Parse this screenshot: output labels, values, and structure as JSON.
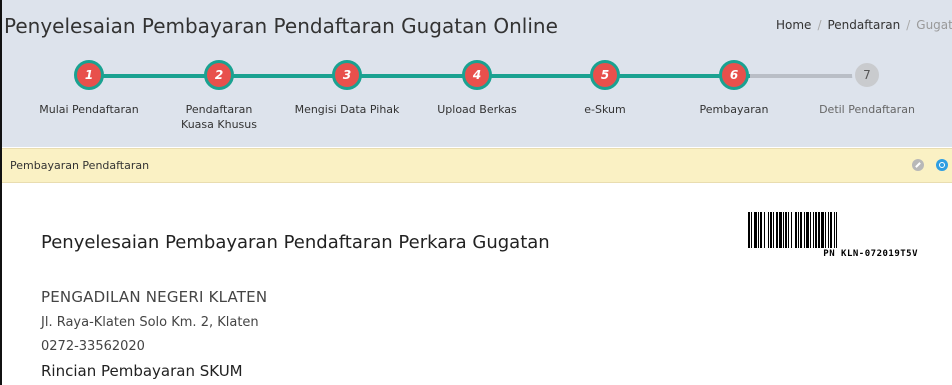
{
  "header": {
    "title": "Penyelesaian Pembayaran Pendaftaran Gugatan Online",
    "breadcrumb": [
      "Home",
      "Pendaftaran",
      "Gugatan"
    ]
  },
  "steps": [
    {
      "number": "1",
      "label": "Mulai Pendaftaran",
      "status": "done"
    },
    {
      "number": "2",
      "label": "Pendaftaran Kuasa Khusus",
      "status": "done"
    },
    {
      "number": "3",
      "label": "Mengisi Data Pihak",
      "status": "done"
    },
    {
      "number": "4",
      "label": "Upload Berkas",
      "status": "done"
    },
    {
      "number": "5",
      "label": "e-Skum",
      "status": "done"
    },
    {
      "number": "6",
      "label": "Pembayaran",
      "status": "done"
    },
    {
      "number": "7",
      "label": "Detil Pendaftaran",
      "status": "pending"
    }
  ],
  "panel": {
    "title": "Pembayaran Pendaftaran",
    "icons": [
      "collapse-icon",
      "refresh-icon"
    ]
  },
  "document": {
    "title": "Penyelesaian Pembayaran Pendaftaran Perkara Gugatan",
    "barcode_text": "PN KLN-072019T5V",
    "court_name": "PENGADILAN NEGERI KLATEN",
    "address": "Jl. Raya-Klaten Solo Km. 2, Klaten",
    "phone": "0272-33562020",
    "section_heading": "Rincian Pembayaran SKUM"
  },
  "colors": {
    "header_bg": "#dde3ec",
    "step_done": "#e8504c",
    "step_track": "#1aa291",
    "step_pending": "#c9cbce",
    "panel_bg": "#faf1c4"
  }
}
